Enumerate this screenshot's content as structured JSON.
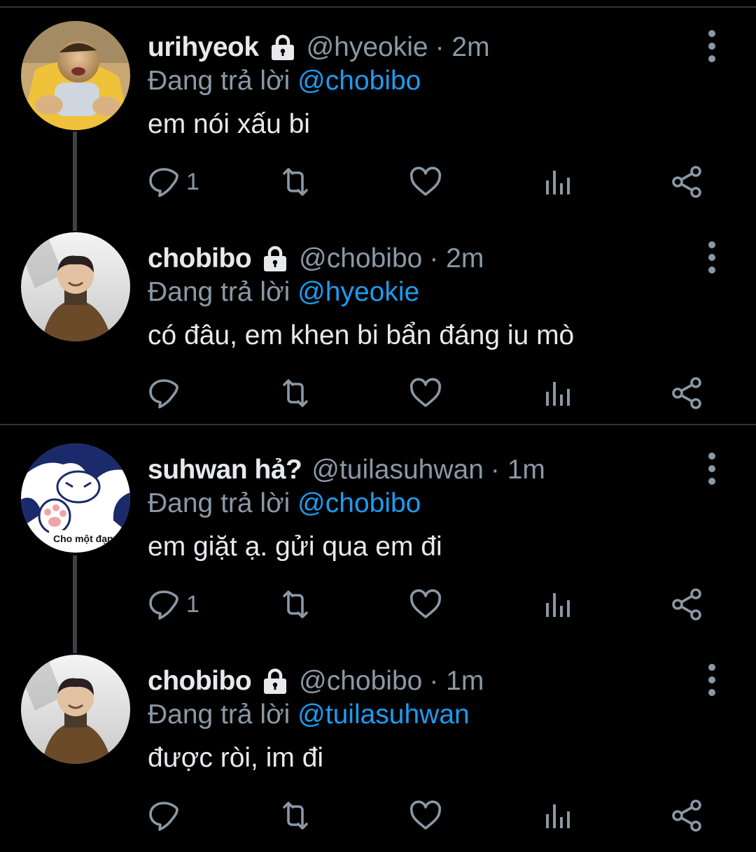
{
  "reply_prefix": "Đang trả lời",
  "colors": {
    "background": "#000000",
    "text": "#e7e9ea",
    "muted": "#8b98a5",
    "link": "#1d9bf0",
    "divider": "#2f3336"
  },
  "icons": {
    "lock": "lock-icon",
    "more": "more-vertical-icon",
    "reply": "reply-icon",
    "retweet": "retweet-icon",
    "like": "heart-icon",
    "views": "analytics-icon",
    "share": "share-icon"
  },
  "tweets": [
    {
      "name": "urihyeok",
      "handle": "@hyeokie",
      "time": "· 2m",
      "reply_to": "@chobibo",
      "text": "em nói xấu bi",
      "reply_count": "1",
      "locked": true
    },
    {
      "name": "chobibo",
      "handle": "@chobibo",
      "time": "· 2m",
      "reply_to": "@hyeokie",
      "text": "có đâu, em khen bi bẩn đáng iu mò",
      "reply_count": "",
      "locked": true
    },
    {
      "name": "suhwan hả?",
      "handle": "@tuilasuhwan",
      "time": "· 1m",
      "reply_to": "@chobibo",
      "text": "em giặt ạ. gửi qua em đi",
      "reply_count": "1",
      "locked": false,
      "avatar_caption": "Cho một đạn"
    },
    {
      "name": "chobibo",
      "handle": "@chobibo",
      "time": "· 1m",
      "reply_to": "@tuilasuhwan",
      "text": "được ròi, im đi",
      "reply_count": "",
      "locked": true
    }
  ]
}
